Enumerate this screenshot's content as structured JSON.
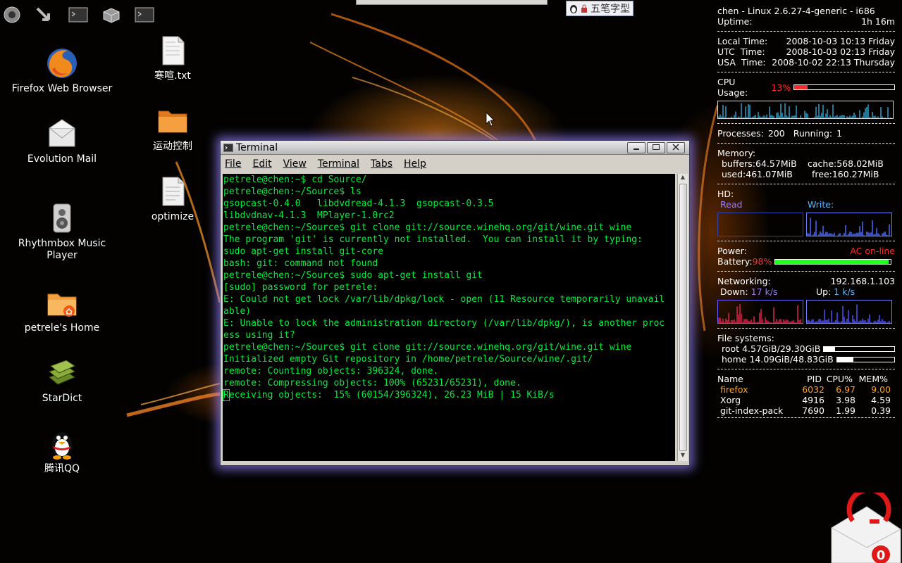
{
  "launcher": [
    {
      "name": "system-menu-icon"
    },
    {
      "name": "download-arrow-icon"
    },
    {
      "name": "terminal-icon"
    },
    {
      "name": "box-icon"
    },
    {
      "name": "terminal-icon-2"
    }
  ],
  "desktop_icons": [
    {
      "label": "Firefox Web Browser",
      "icon": "firefox-icon"
    },
    {
      "label": "Evolution Mail",
      "icon": "mail-icon"
    },
    {
      "label": "Rhythmbox Music Player",
      "icon": "speaker-icon"
    },
    {
      "label": "petrele's Home",
      "icon": "home-folder-icon"
    },
    {
      "label": "StarDict",
      "icon": "book-icon"
    },
    {
      "label": "腾讯QQ",
      "icon": "penguin-icon"
    },
    {
      "label": "寒喧.txt",
      "icon": "text-file-icon"
    },
    {
      "label": "运动控制",
      "icon": "folder-icon"
    },
    {
      "label": "optimize",
      "icon": "document-icon"
    }
  ],
  "ime": {
    "label": "五笔字型"
  },
  "terminal": {
    "title": "Terminal",
    "menus": [
      "File",
      "Edit",
      "View",
      "Terminal",
      "Tabs",
      "Help"
    ],
    "lines": [
      "petrele@chen:~$ cd Source/",
      "petrele@chen:~/Source$ ls",
      "gsopcast-0.4.0   libdvdread-4.1.3  gsopcast-0.3.5",
      "libdvdnav-4.1.3  MPlayer-1.0rc2",
      "petrele@chen:~/Source$ git clone git://source.winehq.org/git/wine.git wine",
      "The program 'git' is currently not installed.  You can install it by typing:",
      "sudo apt-get install git-core",
      "bash: git: command not found",
      "petrele@chen:~/Source$ sudo apt-get install git",
      "[sudo] password for petrele:",
      "E: Could not get lock /var/lib/dpkg/lock - open (11 Resource temporarily unavail",
      "able)",
      "E: Unable to lock the administration directory (/var/lib/dpkg/), is another proc",
      "ess using it?",
      "petrele@chen:~/Source$ git clone git://source.winehq.org/git/wine.git wine",
      "Initialized empty Git repository in /home/petrele/Source/wine/.git/",
      "remote: Counting objects: 396324, done.",
      "remote: Compressing objects: 100% (65231/65231), done."
    ],
    "cursor_char": "R",
    "cursor_line_rest": "eceiving objects:  15% (60154/396324), 26.23 MiB | 15 KiB/s"
  },
  "conky": {
    "system": "chen - Linux 2.6.27-4-generic - i686",
    "uptime_label": "Uptime:",
    "uptime_value": "1h 16m",
    "local_time_label": "Local Time:",
    "local_time_value": "2008-10-03 10:13 Friday",
    "utc_time_label": "UTC  Time:",
    "utc_time_value": "2008-10-03 02:13 Friday",
    "usa_time_label": "USA  Time:",
    "usa_time_value": "2008-10-02 22:13 Thursday",
    "cpu_label": "CPU Usage:",
    "cpu_value": "13%",
    "cpu_fraction": 0.13,
    "processes_label": "Processes:",
    "processes_value": "200",
    "running_label": "Running:",
    "running_value": "1",
    "memory_label": "Memory:",
    "buffers_label": "buffers:",
    "buffers_value": "64.57MiB",
    "cache_label": "cache:",
    "cache_value": "568.02MiB",
    "used_label": "used:",
    "used_value": "461.07MiB",
    "free_label": "free:",
    "free_value": "160.27MiB",
    "hd_label": "HD:",
    "read_label": "Read",
    "write_label": "Write:",
    "power_label": "Power:",
    "power_value": "AC on-line",
    "battery_label": "Battery:",
    "battery_value": "98%",
    "battery_fraction": 0.98,
    "networking_label": "Networking:",
    "ip_value": "192.168.1.103",
    "down_label": "Down:",
    "down_value": "17 k/s",
    "up_label": "Up:",
    "up_value": "1 k/s",
    "fs_label": "File systems:",
    "fs": [
      {
        "name": "root",
        "value": "4.57GiB/29.30GiB",
        "fraction": 0.156
      },
      {
        "name": "home",
        "value": "14.09GiB/48.83GiB",
        "fraction": 0.289
      }
    ],
    "proc_headers": [
      "Name",
      "PID",
      "CPU%",
      "MEM%"
    ],
    "procs": [
      {
        "name": "firefox",
        "pid": "6032",
        "cpu": "6.97",
        "mem": "9.00"
      },
      {
        "name": "Xorg",
        "pid": "4916",
        "cpu": "3.98",
        "mem": "4.59"
      },
      {
        "name": "git-index-pack",
        "pid": "7690",
        "cpu": "1.99",
        "mem": "0.39"
      }
    ]
  },
  "mail_notifier": {
    "count": "0"
  },
  "colors": {
    "terminal_text": "#00ee3c",
    "conky_red": "#ff2a2a",
    "conky_orange": "#ffa21a",
    "conky_cyan": "#58b8ff",
    "conky_violet": "#9a7bff"
  }
}
